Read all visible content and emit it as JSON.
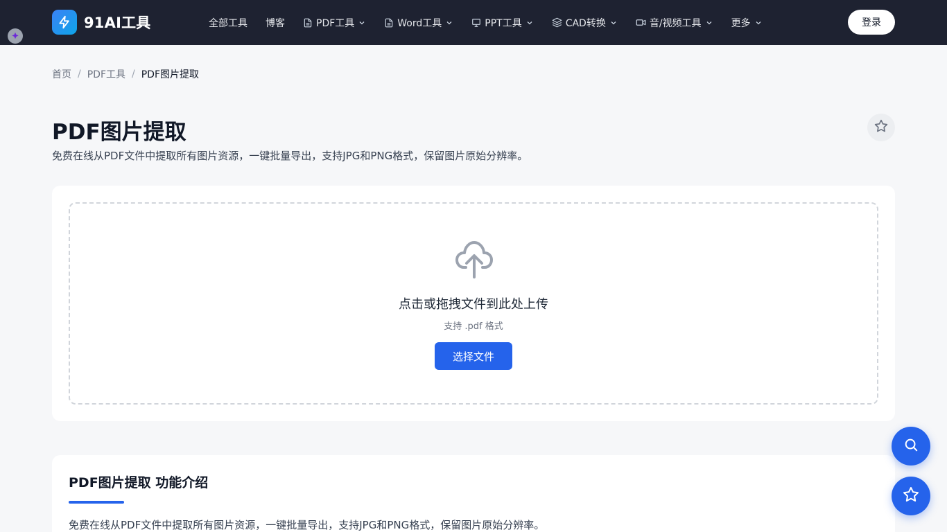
{
  "header": {
    "brand_name": "91AI工具",
    "nav": [
      {
        "label": "全部工具",
        "icon": "",
        "dropdown": false
      },
      {
        "label": "博客",
        "icon": "",
        "dropdown": false
      },
      {
        "label": "PDF工具",
        "icon": "document-icon",
        "dropdown": true
      },
      {
        "label": "Word工具",
        "icon": "document-icon",
        "dropdown": true
      },
      {
        "label": "PPT工具",
        "icon": "presentation-icon",
        "dropdown": true
      },
      {
        "label": "CAD转换",
        "icon": "layers-icon",
        "dropdown": true
      },
      {
        "label": "音/视频工具",
        "icon": "video-camera-icon",
        "dropdown": true
      },
      {
        "label": "更多",
        "icon": "",
        "dropdown": true
      }
    ],
    "login_label": "登录"
  },
  "breadcrumb": {
    "home": "首页",
    "parent": "PDF工具",
    "current": "PDF图片提取"
  },
  "page": {
    "title": "PDF图片提取",
    "subtitle": "免费在线从PDF文件中提取所有图片资源，一键批量导出，支持JPG和PNG格式，保留图片原始分辨率。"
  },
  "upload": {
    "title": "点击或拖拽文件到此处上传",
    "hint": "支持 .pdf 格式",
    "button_label": "选择文件"
  },
  "intro": {
    "title": "PDF图片提取 功能介绍",
    "text": "免费在线从PDF文件中提取所有图片资源，一键批量导出，支持JPG和PNG格式，保留图片原始分辨率。"
  },
  "colors": {
    "header_bg": "#1e2231",
    "accent": "#2563eb",
    "page_bg": "#f6f7f9"
  }
}
